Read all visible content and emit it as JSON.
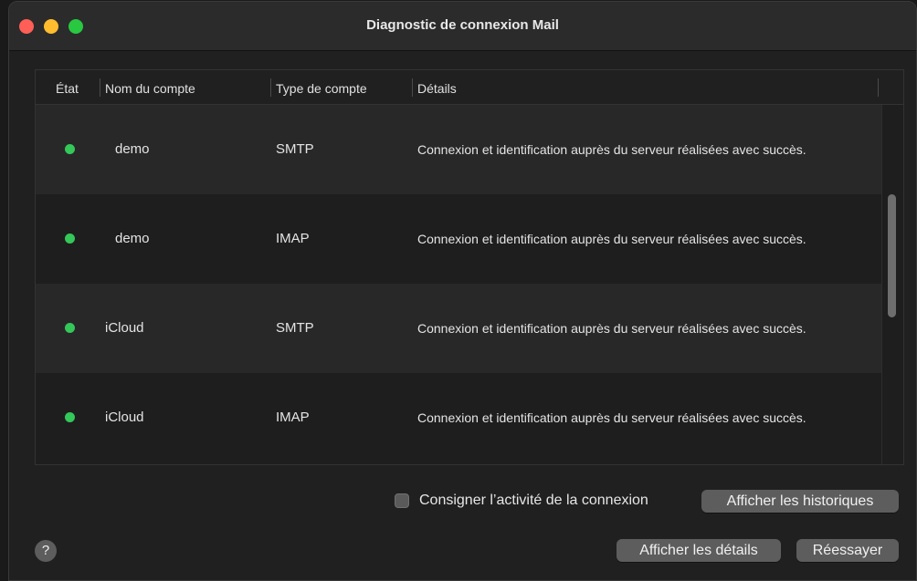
{
  "window": {
    "title": "Diagnostic de connexion Mail"
  },
  "table": {
    "columns": [
      "État",
      "Nom du compte",
      "Type de compte",
      "Détails"
    ],
    "rows": [
      {
        "status": "green",
        "account": "demo",
        "type": "SMTP",
        "details": "Connexion et identification auprès du serveur réalisées avec succès."
      },
      {
        "status": "green",
        "account": "demo",
        "type": "IMAP",
        "details": "Connexion et identification auprès du serveur réalisées avec succès."
      },
      {
        "status": "green",
        "account": "iCloud",
        "type": "SMTP",
        "details": "Connexion et identification auprès du serveur réalisées avec succès."
      },
      {
        "status": "green",
        "account": "iCloud",
        "type": "IMAP",
        "details": "Connexion et identification auprès du serveur réalisées avec succès."
      }
    ]
  },
  "footer": {
    "log_checkbox_label": "Consigner l’activité de la connexion",
    "log_checkbox_checked": false,
    "show_logs_label": "Afficher les historiques",
    "show_details_label": "Afficher les détails",
    "retry_label": "Réessayer",
    "help_label": "?"
  },
  "colors": {
    "status_ok": "#34c759",
    "close": "#ff5f57",
    "minimize": "#febc2e",
    "maximize": "#28c840"
  }
}
